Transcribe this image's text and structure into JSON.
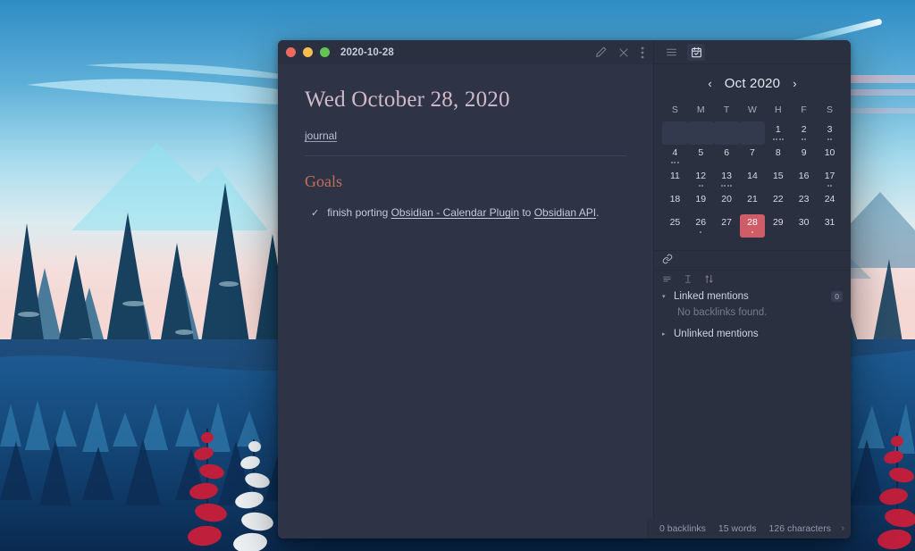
{
  "window": {
    "tab_title": "2020-10-28",
    "traffic_lights": [
      "close",
      "minimize",
      "zoom"
    ],
    "title_actions": [
      {
        "name": "edit-pencil-icon",
        "label": "Edit"
      },
      {
        "name": "close-icon",
        "label": "Close"
      },
      {
        "name": "more-options-icon",
        "label": "More options"
      }
    ]
  },
  "note": {
    "h1": "Wed October 28, 2020",
    "tag": "journal",
    "h2": "Goals",
    "task": {
      "check": "✓",
      "prefix": "finish porting ",
      "link1": "Obsidian - Calendar Plugin",
      "middle": " to ",
      "link2": "Obsidian API",
      "suffix": "."
    }
  },
  "sidebar": {
    "tabs": [
      {
        "name": "file-explorer-icon",
        "label": "File explorer",
        "active": false
      },
      {
        "name": "calendar-icon",
        "label": "Calendar",
        "active": true
      }
    ],
    "calendar": {
      "prev_label": "‹",
      "next_label": "›",
      "title": "Oct 2020",
      "weekdays": [
        "S",
        "M",
        "T",
        "W",
        "H",
        "F",
        "S"
      ],
      "weeks": [
        [
          {
            "day": "",
            "dots": 0,
            "filler": true
          },
          {
            "day": "",
            "dots": 0,
            "filler": true
          },
          {
            "day": "",
            "dots": 0,
            "filler": true
          },
          {
            "day": "",
            "dots": 0,
            "filler": true
          },
          {
            "day": "1",
            "dots": 4
          },
          {
            "day": "2",
            "dots": 2
          },
          {
            "day": "3",
            "dots": 2
          }
        ],
        [
          {
            "day": "4",
            "dots": 3
          },
          {
            "day": "5",
            "dots": 0
          },
          {
            "day": "6",
            "dots": 0
          },
          {
            "day": "7",
            "dots": 0
          },
          {
            "day": "8",
            "dots": 0
          },
          {
            "day": "9",
            "dots": 0
          },
          {
            "day": "10",
            "dots": 0
          }
        ],
        [
          {
            "day": "11",
            "dots": 0
          },
          {
            "day": "12",
            "dots": 2
          },
          {
            "day": "13",
            "dots": 4
          },
          {
            "day": "14",
            "dots": 0
          },
          {
            "day": "15",
            "dots": 0
          },
          {
            "day": "16",
            "dots": 0
          },
          {
            "day": "17",
            "dots": 2
          }
        ],
        [
          {
            "day": "18",
            "dots": 0
          },
          {
            "day": "19",
            "dots": 0
          },
          {
            "day": "20",
            "dots": 0
          },
          {
            "day": "21",
            "dots": 0
          },
          {
            "day": "22",
            "dots": 0
          },
          {
            "day": "23",
            "dots": 0
          },
          {
            "day": "24",
            "dots": 0
          }
        ],
        [
          {
            "day": "25",
            "dots": 0
          },
          {
            "day": "26",
            "dots": 1
          },
          {
            "day": "27",
            "dots": 0
          },
          {
            "day": "28",
            "dots": 1,
            "today": true
          },
          {
            "day": "29",
            "dots": 0
          },
          {
            "day": "30",
            "dots": 0
          },
          {
            "day": "31",
            "dots": 0
          }
        ]
      ]
    },
    "backlinks": {
      "pane_icon": "link-icon",
      "toolbar": [
        {
          "name": "collapse-results-icon",
          "label": "Collapse results"
        },
        {
          "name": "show-context-icon",
          "label": "Show more context"
        },
        {
          "name": "sort-order-icon",
          "label": "Change sort order"
        }
      ],
      "linked_mentions_label": "Linked mentions",
      "linked_mentions_count": "0",
      "empty_text": "No backlinks found.",
      "unlinked_mentions_label": "Unlinked mentions",
      "caret_open": "▾",
      "caret_closed": "▸"
    }
  },
  "status_bar": {
    "backlinks": "0 backlinks",
    "words": "15 words",
    "characters": "126 characters",
    "chevron": "›"
  },
  "colors": {
    "accent_today": "#ce5d67",
    "heading_h1": "#cfb9c9",
    "heading_h2": "#c2705c",
    "window_bg": "#2e3445",
    "sidebar_bg": "#2b3040"
  }
}
